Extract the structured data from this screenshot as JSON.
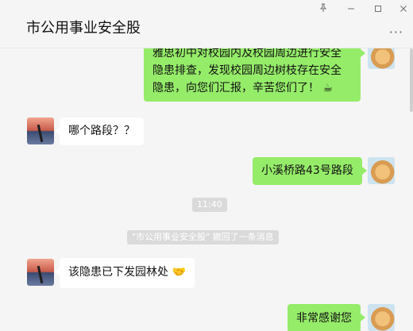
{
  "window": {
    "title": "市公用事业安全股",
    "pin_icon": "pin-icon",
    "minimize_icon": "minimize-icon",
    "maximize_icon": "maximize-icon",
    "close_icon": "close-icon",
    "more_label": "···"
  },
  "messages": [
    {
      "side": "self",
      "text": "雅思初中对校园内及校园周边进行安全隐患排查，发现校园周边树枝存在安全隐患，向您们汇报，辛苦您们了！",
      "emoji": "☕"
    },
    {
      "side": "other",
      "text": "哪个路段？？"
    },
    {
      "side": "self",
      "text": "小溪桥路43号路段"
    },
    {
      "side": "other",
      "text": "该隐患已下发园林处",
      "emoji": "🤝"
    },
    {
      "side": "self",
      "text": "非常感谢您"
    }
  ],
  "system": {
    "time": "11:40",
    "recall_notice": "\"市公用事业安全股\" 撤回了一条消息"
  },
  "colors": {
    "self_bubble": "#95ec69",
    "other_bubble": "#ffffff",
    "background": "#f5f5f5"
  }
}
